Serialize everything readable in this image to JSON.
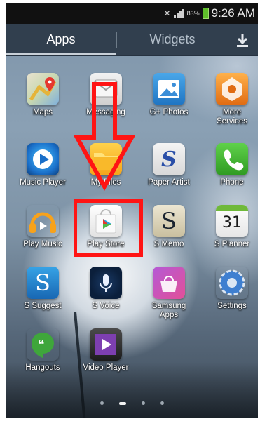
{
  "status_bar": {
    "battery": "83%",
    "time": "9:26 AM",
    "icons": [
      "mute-icon",
      "signal-icon",
      "battery-icon"
    ]
  },
  "tabs": {
    "apps": "Apps",
    "widgets": "Widgets",
    "download_icon": "download-icon"
  },
  "apps": [
    {
      "label": "Maps",
      "icon": "maps-icon"
    },
    {
      "label": "Messaging",
      "icon": "messaging-icon"
    },
    {
      "label": "G+ Photos",
      "icon": "photos-icon"
    },
    {
      "label": "More\nServices",
      "icon": "more-services-icon"
    },
    {
      "label": "Music Player",
      "icon": "music-player-icon"
    },
    {
      "label": "My Files",
      "icon": "my-files-icon"
    },
    {
      "label": "Paper Artist",
      "icon": "paper-artist-icon"
    },
    {
      "label": "Phone",
      "icon": "phone-icon"
    },
    {
      "label": "Play Music",
      "icon": "play-music-icon"
    },
    {
      "label": "Play Store",
      "icon": "play-store-icon"
    },
    {
      "label": "S Memo",
      "icon": "s-memo-icon"
    },
    {
      "label": "S Planner",
      "icon": "s-planner-icon"
    },
    {
      "label": "S Suggest",
      "icon": "s-suggest-icon"
    },
    {
      "label": "S Voice",
      "icon": "s-voice-icon"
    },
    {
      "label": "Samsung\nApps",
      "icon": "samsung-apps-icon"
    },
    {
      "label": "Settings",
      "icon": "settings-icon"
    },
    {
      "label": "Hangouts",
      "icon": "hangouts-icon"
    },
    {
      "label": "Video Player",
      "icon": "video-player-icon"
    }
  ],
  "icon_glyphs": {
    "s_memo": "S",
    "s_suggest": "S",
    "s_planner_day": "31",
    "paper_artist": "S"
  },
  "pager": {
    "pages": 4,
    "active_page": 2
  },
  "annotation": {
    "highlight_color": "#ff1414",
    "arrow_color": "#ff1414",
    "target": "Play Store"
  }
}
